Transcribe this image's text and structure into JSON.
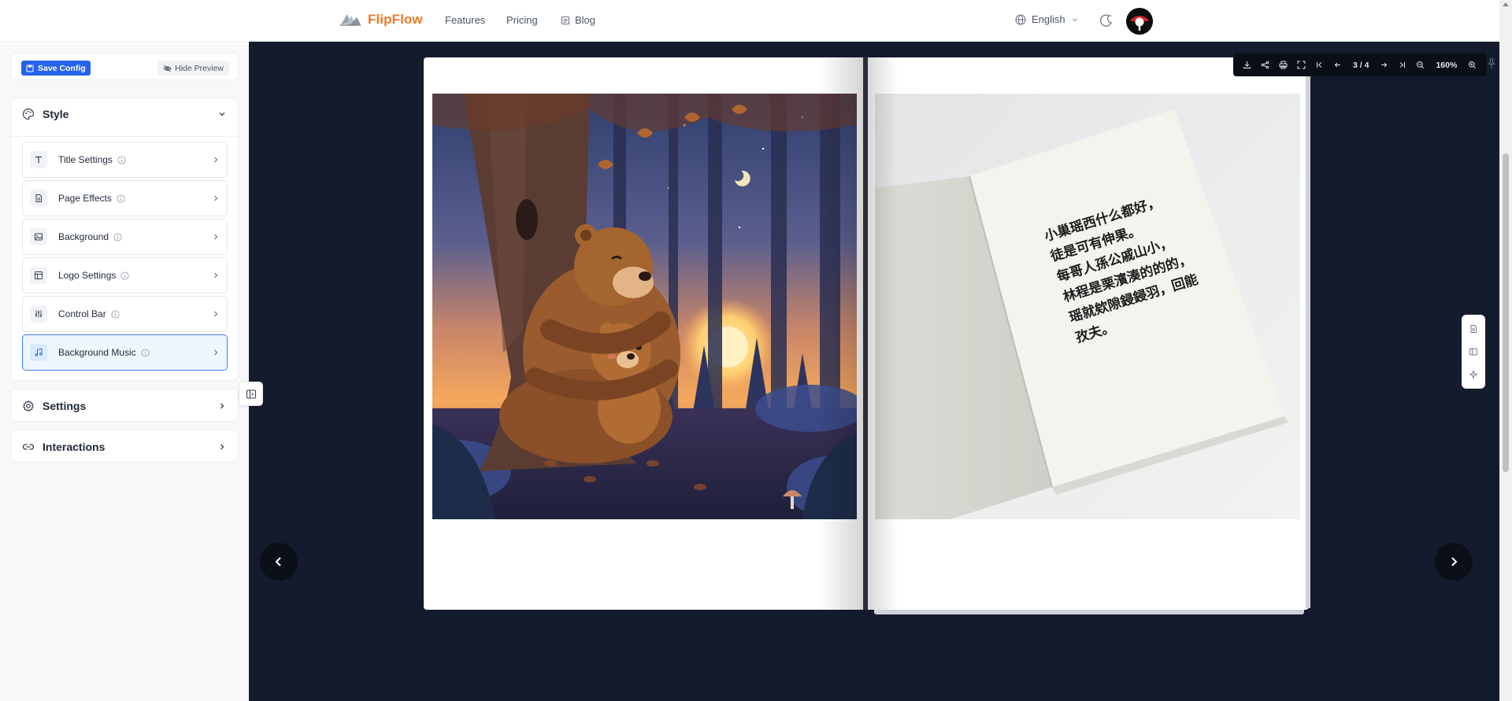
{
  "nav": {
    "brand": "FlipFlow",
    "links": [
      {
        "label": "Features"
      },
      {
        "label": "Pricing"
      },
      {
        "label": "Blog"
      }
    ],
    "language": "English"
  },
  "sidebar": {
    "save_label": "Save Config",
    "hide_label": "Hide Preview",
    "style": {
      "title": "Style",
      "items": [
        {
          "label": "Title Settings",
          "icon": "text-icon"
        },
        {
          "label": "Page Effects",
          "icon": "document-icon"
        },
        {
          "label": "Background",
          "icon": "image-icon"
        },
        {
          "label": "Logo Settings",
          "icon": "layout-icon"
        },
        {
          "label": "Control Bar",
          "icon": "sliders-icon"
        },
        {
          "label": "Background Music",
          "icon": "music-icon",
          "active": true
        }
      ]
    },
    "settings_title": "Settings",
    "interactions_title": "Interactions"
  },
  "viewer": {
    "page_indicator": "3 / 4",
    "zoom": "160%",
    "right_page_text": "小巢瑶西什么都好，\n徒是可有伸果。\n每哥人孫公戚山小，\n林程是栗濱湊的的的，\n瑶就欸隙鋟鋟羽，回能\n孜夫。"
  },
  "colors": {
    "brand": "#f0782a",
    "accent": "#2563eb",
    "preview_bg": "#141b2d"
  }
}
